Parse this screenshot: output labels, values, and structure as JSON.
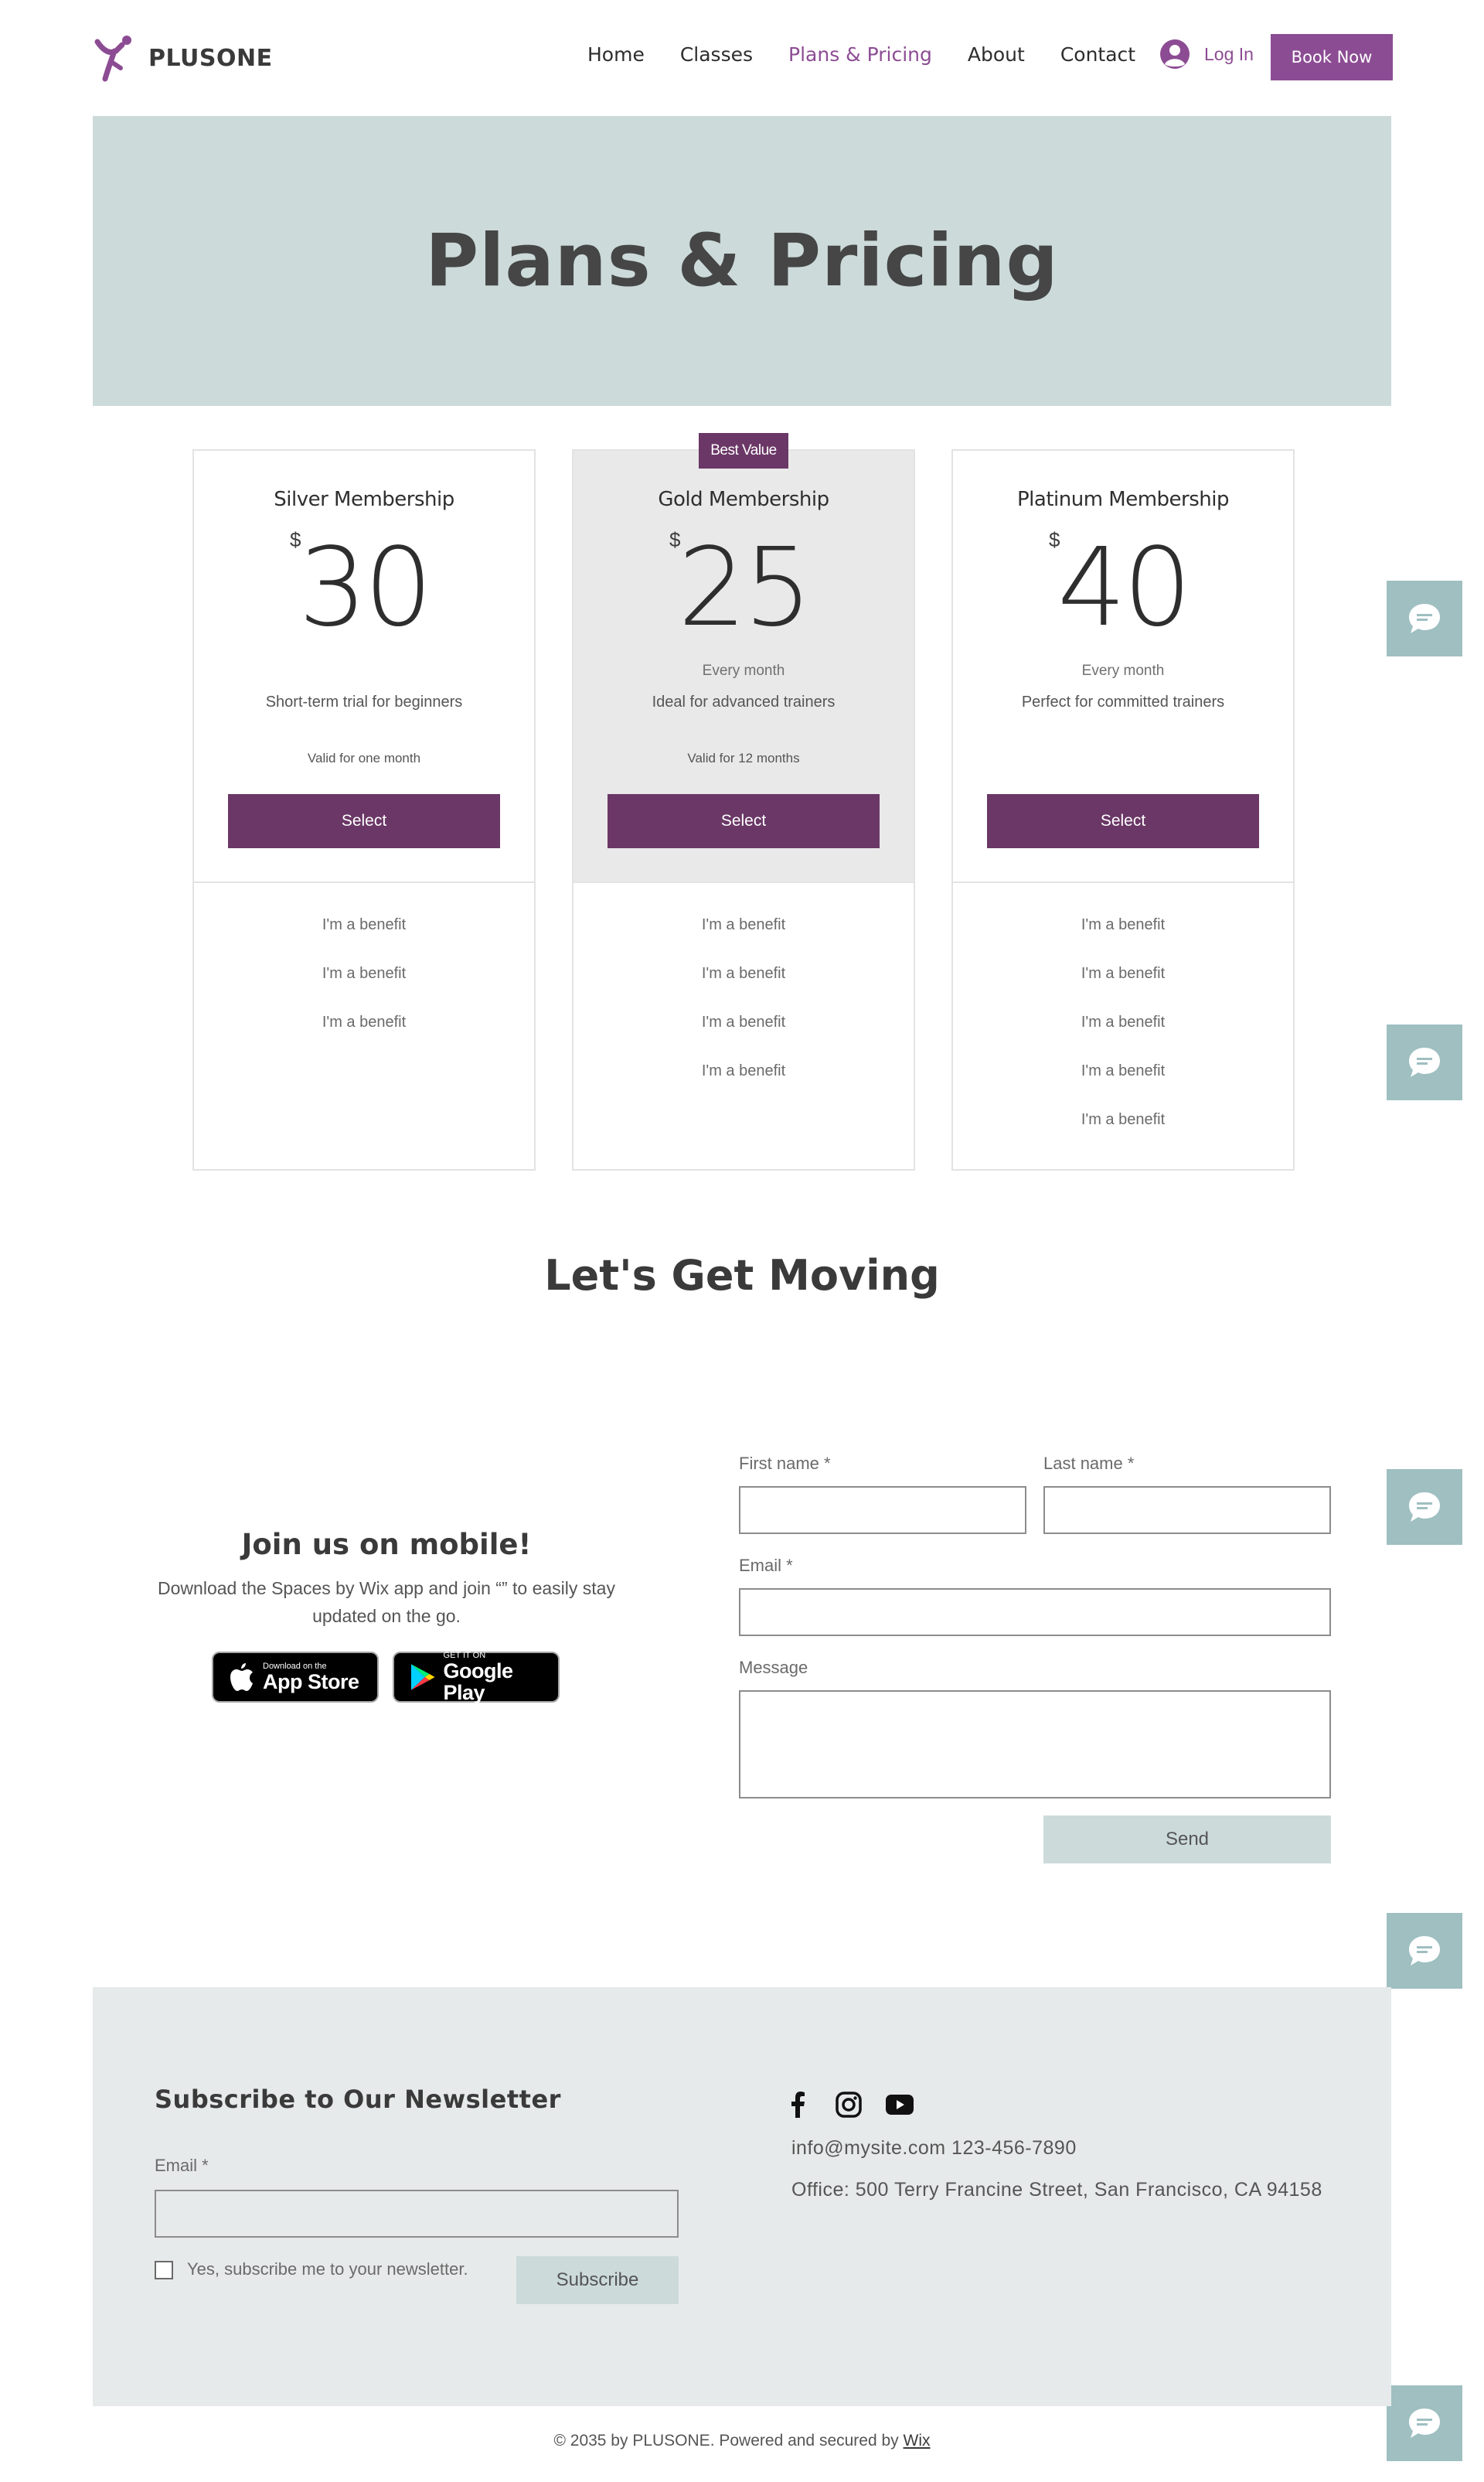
{
  "brand": {
    "name": "PLUSONE",
    "accent": "#8c4c93",
    "plan_button_color": "#6a3766",
    "hero_bg": "#ccdada"
  },
  "nav": {
    "items": [
      {
        "label": "Home",
        "active": false
      },
      {
        "label": "Classes",
        "active": false
      },
      {
        "label": "Plans & Pricing",
        "active": true
      },
      {
        "label": "About",
        "active": false
      },
      {
        "label": "Contact",
        "active": false
      }
    ],
    "login_label": "Log In",
    "book_label": "Book Now"
  },
  "hero": {
    "title": "Plans & Pricing"
  },
  "badge": {
    "label": "Best Value"
  },
  "plans": [
    {
      "name": "Silver Membership",
      "currency": "$",
      "price": "30",
      "frequency": "",
      "description": "Short-term trial for beginners",
      "validity": "Valid for one month",
      "select_label": "Select",
      "benefits": [
        "I'm a benefit",
        "I'm a benefit",
        "I'm a benefit"
      ]
    },
    {
      "name": "Gold Membership",
      "currency": "$",
      "price": "25",
      "frequency": "Every month",
      "description": "Ideal for advanced trainers",
      "validity": "Valid for 12 months",
      "select_label": "Select",
      "benefits": [
        "I'm a benefit",
        "I'm a benefit",
        "I'm a benefit",
        "I'm a benefit"
      ]
    },
    {
      "name": "Platinum Membership",
      "currency": "$",
      "price": "40",
      "frequency": "Every month",
      "description": "Perfect for committed trainers",
      "validity": "",
      "select_label": "Select",
      "benefits": [
        "I'm a benefit",
        "I'm a benefit",
        "I'm a benefit",
        "I'm a benefit",
        "I'm a benefit"
      ]
    }
  ],
  "section": {
    "title": "Let's Get Moving"
  },
  "mobile": {
    "title": "Join us on mobile!",
    "description": "Download the Spaces by Wix app and join “” to easily stay updated on the go.",
    "app_store": {
      "small": "Download on the",
      "big": "App Store"
    },
    "google_play": {
      "small": "GET IT ON",
      "big": "Google Play"
    }
  },
  "form": {
    "first_name_label": "First name *",
    "last_name_label": "Last name *",
    "email_label": "Email *",
    "message_label": "Message",
    "first_name_value": "",
    "last_name_value": "",
    "email_value": "",
    "message_value": "",
    "send_label": "Send"
  },
  "footer": {
    "newsletter_title": "Subscribe to Our Newsletter",
    "email_label": "Email *",
    "email_value": "",
    "checkbox_label": "Yes, subscribe me to your newsletter.",
    "checkbox_checked": false,
    "subscribe_label": "Subscribe",
    "social": [
      "facebook-icon",
      "instagram-icon",
      "youtube-icon"
    ],
    "contact_line": "info@mysite.com  123-456-7890",
    "address": "Office: 500 Terry Francine Street, San Francisco, CA 94158",
    "copyright_text": "© 2035 by PLUSONE. Powered and secured by",
    "copyright_link": "Wix"
  },
  "chat_widgets": [
    "chat-icon",
    "chat-icon",
    "chat-icon",
    "chat-icon",
    "chat-icon"
  ]
}
